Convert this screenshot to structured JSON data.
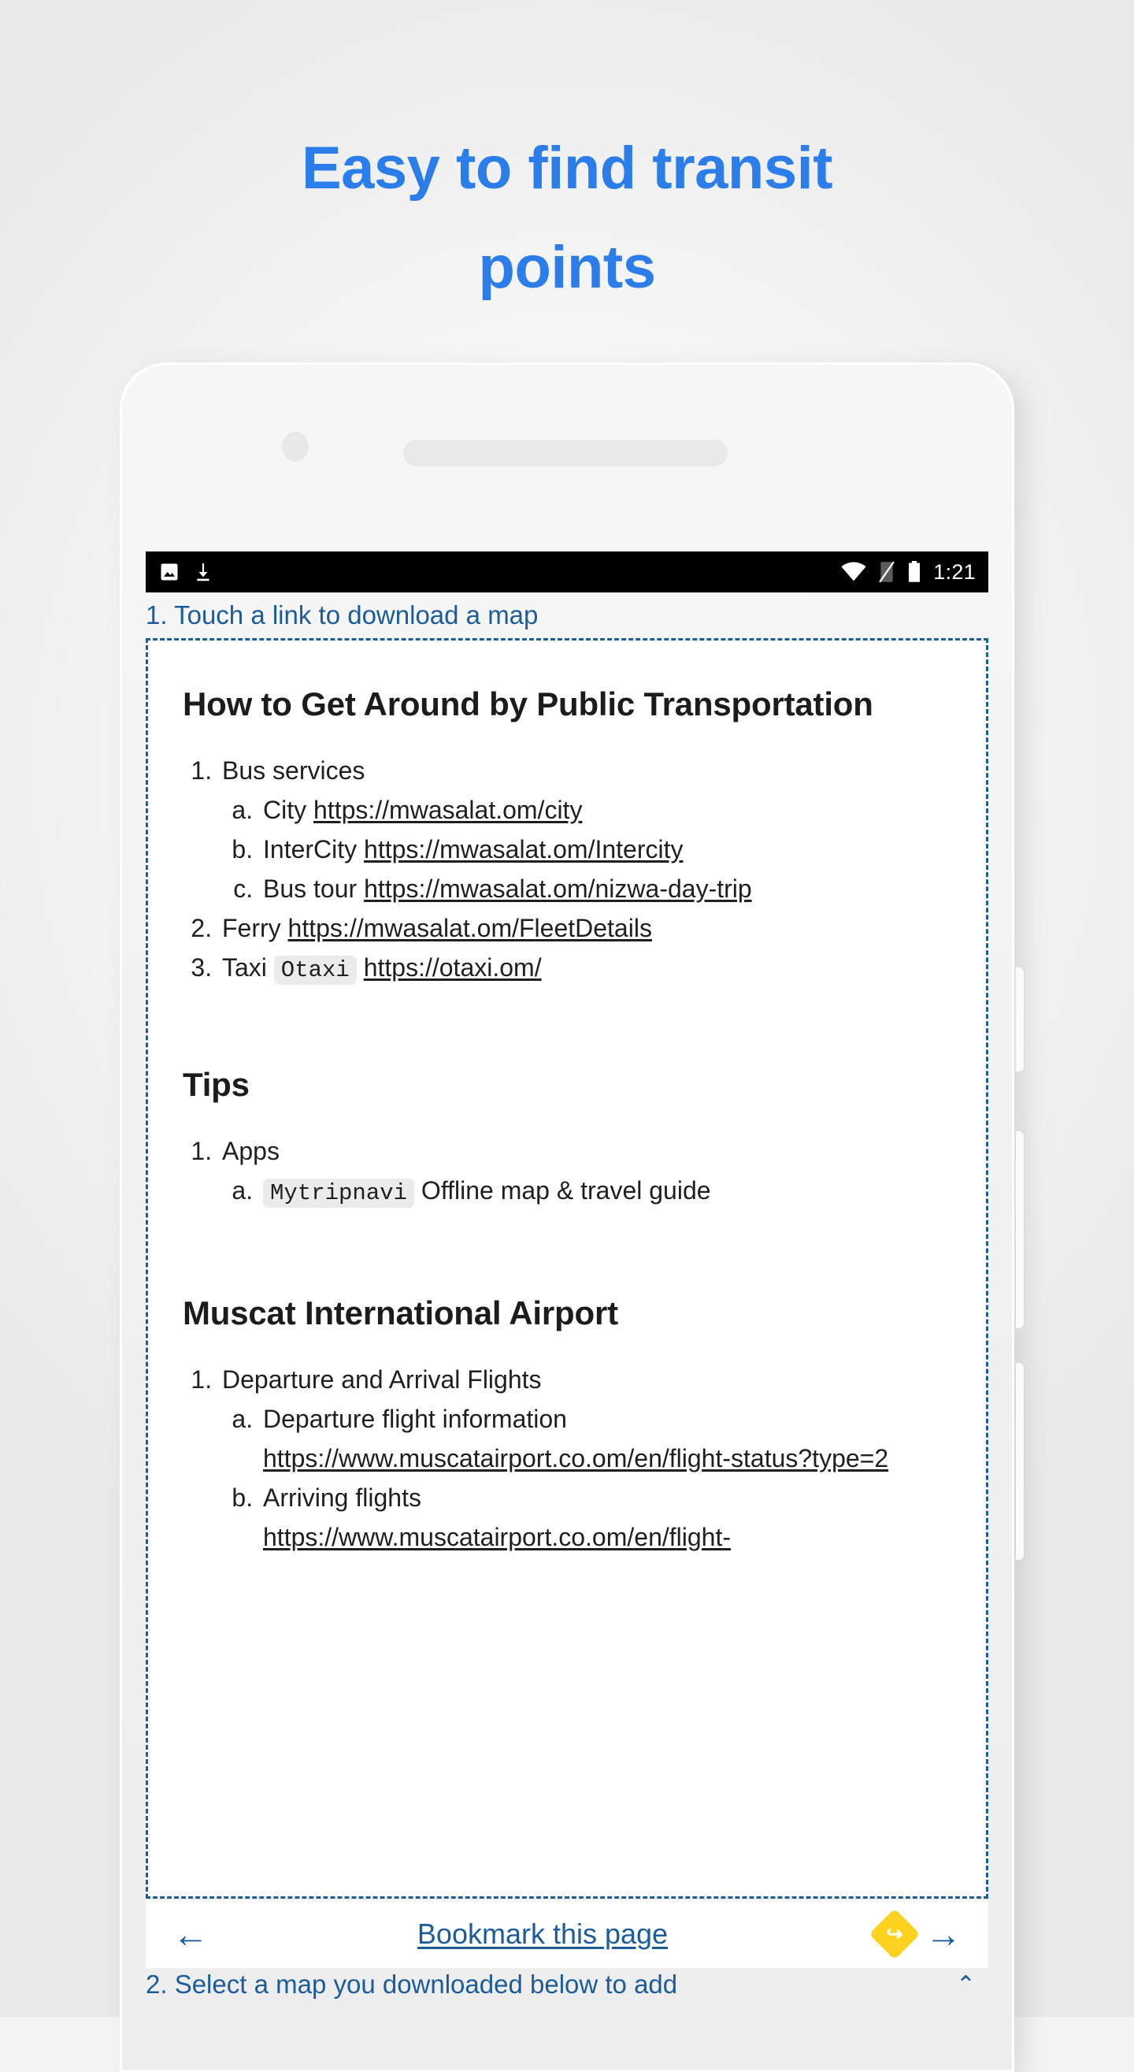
{
  "headline": {
    "line1": "Easy to find transit",
    "line2": "points"
  },
  "statusbar": {
    "time": "1:21",
    "icons": [
      "image-icon",
      "download-icon",
      "wifi-icon",
      "no-signal-icon",
      "battery-icon"
    ]
  },
  "steps": {
    "step1": "1. Touch a link to download a map",
    "step2": "2. Select a map you downloaded below to add",
    "step2_chevron": "⌃"
  },
  "document": {
    "heading_transport": "How to Get Around by Public Transportation",
    "transport": [
      {
        "label": "Bus services",
        "sub": [
          {
            "label": "City",
            "link": "https://mwasalat.om/city"
          },
          {
            "label": "InterCity",
            "link": "https://mwasalat.om/Intercity"
          },
          {
            "label": "Bus tour",
            "link": "https://mwasalat.om/nizwa-day-trip"
          }
        ]
      },
      {
        "label": "Ferry",
        "link": "https://mwasalat.om/FleetDetails"
      },
      {
        "label": "Taxi",
        "code": "Otaxi",
        "link": "https://otaxi.om/"
      }
    ],
    "heading_tips": "Tips",
    "tips": [
      {
        "label": "Apps",
        "sub": [
          {
            "code": "Mytripnavi",
            "label": "Offline map & travel guide"
          }
        ]
      }
    ],
    "heading_airport": "Muscat International Airport",
    "airport": [
      {
        "label": "Departure and Arrival Flights",
        "sub": [
          {
            "label": "Departure flight information",
            "link": "https://www.muscatairport.co.om/en/flight-status?type=2"
          },
          {
            "label": "Arriving flights",
            "link": "https://www.muscatairport.co.om/en/flight-"
          }
        ]
      }
    ]
  },
  "browserbar": {
    "back": "←",
    "forward": "→",
    "bookmark_label": "Bookmark this page",
    "share_glyph": "↪"
  },
  "colors": {
    "headline_blue": "#2b7de9",
    "ui_blue": "#1b5c9b",
    "share_yellow": "#ffd21f",
    "statusbar_bg": "#000000"
  }
}
